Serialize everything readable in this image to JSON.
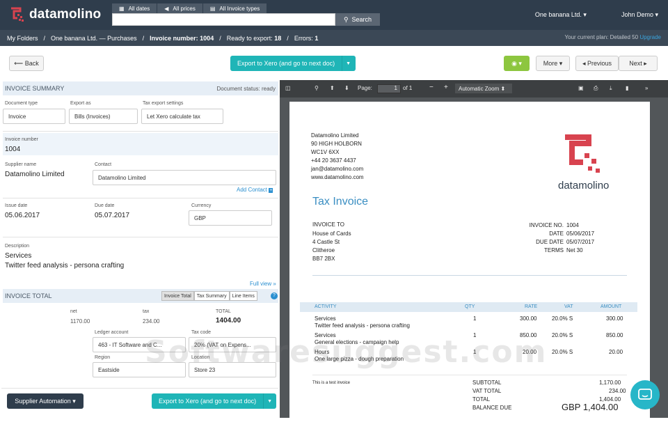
{
  "brand": {
    "name": "datamolino"
  },
  "filters": {
    "dates": "All dates",
    "prices": "All prices",
    "types": "All Invoice types"
  },
  "search": {
    "value": "",
    "button": "Search"
  },
  "user": {
    "company": "One banana Ltd.",
    "name": "John Demo"
  },
  "breadcrumb": {
    "folders": "My Folders",
    "company": "One banana Ltd. — Purchases",
    "invoice_label": "Invoice number:",
    "invoice_num": "1004",
    "ready_label": "Ready to export:",
    "ready_count": "18",
    "errors_label": "Errors:",
    "errors_count": "1",
    "plan_text": "Your current plan: Detailed 50",
    "upgrade": "Upgrade"
  },
  "toolbar": {
    "back": "Back",
    "export": "Export to Xero (and go to next doc)",
    "more": "More",
    "previous": "Previous",
    "next": "Next"
  },
  "summary": {
    "title": "INVOICE SUMMARY",
    "status": "Document status: ready",
    "doc_type_label": "Document type",
    "doc_type": "Invoice",
    "export_as_label": "Export as",
    "export_as": "Bills (Invoices)",
    "tax_settings_label": "Tax export settings",
    "tax_settings": "Let Xero calculate tax",
    "invoice_number_label": "Invoice number",
    "invoice_number": "1004",
    "supplier_label": "Supplier name",
    "supplier": "Datamolino Limited",
    "contact_label": "Contact",
    "contact": "Datamolino Limited",
    "add_contact": "Add Contact",
    "issue_label": "Issue date",
    "issue_date": "05.06.2017",
    "due_label": "Due date",
    "due_date": "05.07.2017",
    "currency_label": "Currency",
    "currency": "GBP",
    "desc_label": "Description",
    "desc_line1": "Services",
    "desc_line2": "Twitter feed analysis - persona crafting",
    "full_view": "Full view"
  },
  "total": {
    "title": "INVOICE TOTAL",
    "tabs": [
      "Invoice Total",
      "Tax Summary",
      "Line Items"
    ],
    "net_label": "net",
    "net": "1170.00",
    "tax_label": "tax",
    "tax": "234.00",
    "total_label": "TOTAL",
    "total": "1404.00",
    "ledger_label": "Ledger account",
    "ledger": "463 - IT Software and C...",
    "taxcode_label": "Tax code",
    "taxcode": "20% (VAT on Expens...",
    "region_label": "Region",
    "region": "Eastside",
    "location_label": "Location",
    "location": "Store 23"
  },
  "footer": {
    "automation": "Supplier Automation",
    "export": "Export to Xero (and go to next doc)"
  },
  "viewer": {
    "page_label": "Page:",
    "page": "1",
    "of": "of 1",
    "zoom": "Automatic Zoom"
  },
  "doc": {
    "from": [
      "Datamolino Limited",
      "90 HIGH HOLBORN",
      "WC1V 6XX",
      "+44 20 3637 4437",
      "jan@datamolino.com",
      "www.datamolino.com"
    ],
    "logo_text": "datamolino",
    "title": "Tax Invoice",
    "invoice_to_label": "INVOICE TO",
    "to": [
      "House of Cards",
      "4 Castle St",
      "Clitheroe",
      "BB7 2BX"
    ],
    "meta_labels": [
      "INVOICE NO.",
      "DATE",
      "DUE DATE",
      "TERMS"
    ],
    "meta_values": [
      "1004",
      "05/06/2017",
      "05/07/2017",
      "Net 30"
    ],
    "cols": [
      "ACTIVITY",
      "QTY",
      "RATE",
      "VAT",
      "AMOUNT"
    ],
    "rows": [
      {
        "name": "Services",
        "desc": "Twitter feed analysis - persona crafting",
        "qty": "1",
        "rate": "300.00",
        "vat": "20.0% S",
        "amount": "300.00"
      },
      {
        "name": "Services",
        "desc": "General elections - campaign help",
        "qty": "1",
        "rate": "850.00",
        "vat": "20.0% S",
        "amount": "850.00"
      },
      {
        "name": "Hours",
        "desc": "One large pizza - dough preparation",
        "qty": "1",
        "rate": "20.00",
        "vat": "20.0% S",
        "amount": "20.00"
      }
    ],
    "note": "This is a test invoice",
    "sum_labels": [
      "SUBTOTAL",
      "VAT TOTAL",
      "TOTAL",
      "BALANCE DUE"
    ],
    "sum_values": [
      "1,170.00",
      "234.00",
      "1,404.00",
      "GBP 1,404.00"
    ]
  },
  "watermark": "Softwaresuggest.com",
  "colors": {
    "teal": "#1fb5b7",
    "green": "#8dc63f",
    "navy": "#2f3d4c",
    "accent_blue": "#3a8ec2",
    "logo_red": "#d8434f"
  }
}
